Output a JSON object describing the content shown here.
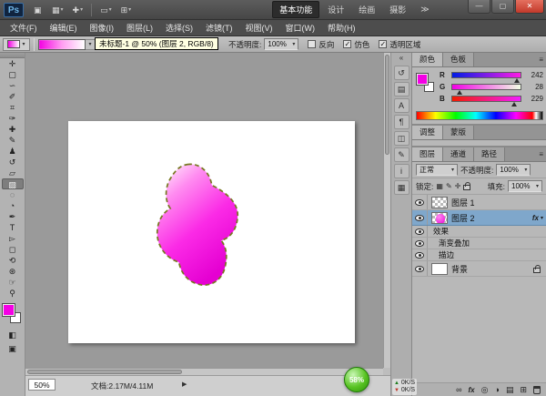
{
  "window": {
    "logo": "Ps",
    "app_bar_icons": [
      {
        "name": "bridge-icon",
        "glyph": "▣"
      },
      {
        "name": "view-extras-icon",
        "glyph": "▦"
      },
      {
        "name": "zoom-tool-icon",
        "glyph": "✚"
      },
      {
        "name": "arrange-documents-icon",
        "glyph": "▭"
      },
      {
        "name": "screen-mode-icon",
        "glyph": "⊞"
      }
    ],
    "workspaces": [
      "基本功能",
      "设计",
      "绘画",
      "摄影"
    ],
    "workspace_overflow": "≫",
    "min_label": "—",
    "max_label": "▢",
    "close_label": "✕"
  },
  "menubar": [
    "文件(F)",
    "编辑(E)",
    "图像(I)",
    "图层(L)",
    "选择(S)",
    "滤镜(T)",
    "视图(V)",
    "窗口(W)",
    "帮助(H)"
  ],
  "options": {
    "preset_caret": "▾",
    "sample_caret": "▾",
    "opacity_label": "不透明度:",
    "opacity_value": "100%",
    "checks": [
      {
        "label": "反向",
        "mark": ""
      },
      {
        "label": "仿色",
        "mark": "✓"
      },
      {
        "label": "透明区域",
        "mark": "✓"
      }
    ]
  },
  "tooltip": "未标题-1 @ 50% (图层 2, RGB/8)",
  "tools": [
    {
      "name": "移动工具",
      "glyph": "✛"
    },
    {
      "name": "矩形选框工具",
      "glyph": "▢"
    },
    {
      "name": "套索工具",
      "glyph": "∽"
    },
    {
      "name": "快速选择工具",
      "glyph": "✐"
    },
    {
      "name": "裁剪工具",
      "glyph": "⌗"
    },
    {
      "name": "吸管工具",
      "glyph": "✑"
    },
    {
      "name": "污点修复画笔工具",
      "glyph": "✚"
    },
    {
      "name": "画笔工具",
      "glyph": "✎"
    },
    {
      "name": "仿制图章工具",
      "glyph": "♟"
    },
    {
      "name": "历史记录画笔工具",
      "glyph": "↺"
    },
    {
      "name": "橡皮擦工具",
      "glyph": "▱"
    },
    {
      "name": "渐变工具",
      "glyph": "▨"
    },
    {
      "name": "模糊工具",
      "glyph": "◌"
    },
    {
      "name": "减淡工具",
      "glyph": "◔"
    },
    {
      "name": "钢笔工具",
      "glyph": "✒"
    },
    {
      "name": "横排文字工具",
      "glyph": "T"
    },
    {
      "name": "路径选择工具",
      "glyph": "▻"
    },
    {
      "name": "矩形工具",
      "glyph": "◻"
    },
    {
      "name": "3D对象旋转工具",
      "glyph": "⟲"
    },
    {
      "name": "3D环绕工具",
      "glyph": "⊛"
    },
    {
      "name": "抓手工具",
      "glyph": "☞"
    },
    {
      "name": "缩放工具",
      "glyph": "⚲"
    }
  ],
  "tools_extra": {
    "quick_mask": "◧",
    "screen_mode": "▣"
  },
  "dock": {
    "collapse": "«",
    "icons": [
      {
        "name": "history-panel-icon",
        "glyph": "↺"
      },
      {
        "name": "styles-panel-icon",
        "glyph": "▤"
      },
      {
        "name": "character-panel-icon",
        "glyph": "A"
      },
      {
        "name": "paragraph-panel-icon",
        "glyph": "¶"
      },
      {
        "name": "clone-source-panel-icon",
        "glyph": "◫"
      },
      {
        "name": "brush-panel-icon",
        "glyph": "✎"
      },
      {
        "name": "info-panel-icon",
        "glyph": "i"
      },
      {
        "name": "navigator-panel-icon",
        "glyph": "▦"
      }
    ]
  },
  "color_panel": {
    "tabs": [
      "颜色",
      "色板"
    ],
    "menu_icon": "≡",
    "channels": [
      {
        "label": "R",
        "value": "242"
      },
      {
        "label": "G",
        "value": "28"
      },
      {
        "label": "B",
        "value": "229"
      }
    ]
  },
  "adjust_panel": {
    "tabs": [
      "调整",
      "蒙版"
    ]
  },
  "layers_panel": {
    "tabs": [
      "图层",
      "通道",
      "路径"
    ],
    "menu_icon": "≡",
    "blend_mode": "正常",
    "opacity_label": "不透明度:",
    "opacity_value": "100%",
    "lock_label": "锁定:",
    "lock_icons": [
      "▦",
      "✎",
      "✛"
    ],
    "fill_label": "填充:",
    "fill_value": "100%",
    "layer1_label": "图层 1",
    "layer2_label": "图层 2",
    "effects_label": "效果",
    "effect1_label": "渐变叠加",
    "effect2_label": "描边",
    "background_label": "背景",
    "fx_badge": "fx",
    "footer_icons": {
      "link": "∞",
      "fx": "fx",
      "mask": "◎",
      "adjust": "◑",
      "group": "▤",
      "new_layer": "⊞"
    }
  },
  "statusbar": {
    "zoom": "50%",
    "doc_info": "文档:2.17M/4.11M",
    "flyout": "▶"
  },
  "overlays": {
    "ball": "58%",
    "net_up": "0K/S",
    "net_down": "0K/S"
  },
  "colors": {
    "foreground": "#f400e4",
    "selected_layer": "#7fa7cb",
    "close_red": "#c2392a"
  }
}
